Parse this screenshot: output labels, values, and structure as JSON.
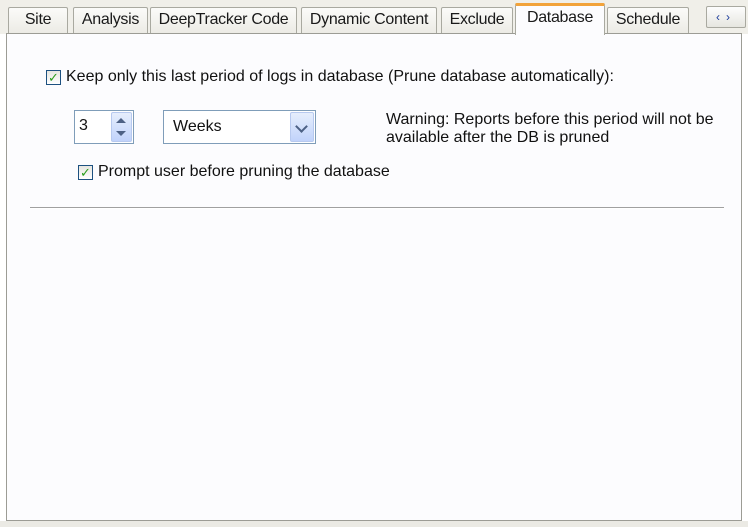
{
  "tabs": [
    {
      "label": "Site",
      "active": false
    },
    {
      "label": "Analysis",
      "active": false
    },
    {
      "label": "DeepTracker Code",
      "active": false
    },
    {
      "label": "Dynamic Content",
      "active": false
    },
    {
      "label": "Exclude",
      "active": false
    },
    {
      "label": "Database",
      "active": true
    },
    {
      "label": "Schedule",
      "active": false
    }
  ],
  "tab_scroll_icons": [
    "chevron-left-icon",
    "chevron-right-icon"
  ],
  "accent_color": "#f2a33a",
  "prune": {
    "checked": true,
    "label": "Keep only this last period of logs in database (Prune database automatically):",
    "period_value": "3",
    "unit_selected": "Weeks",
    "warning": "Warning: Reports before this period will not be available after the DB is pruned",
    "prompt_checked": true,
    "prompt_label": "Prompt user before pruning the database"
  }
}
